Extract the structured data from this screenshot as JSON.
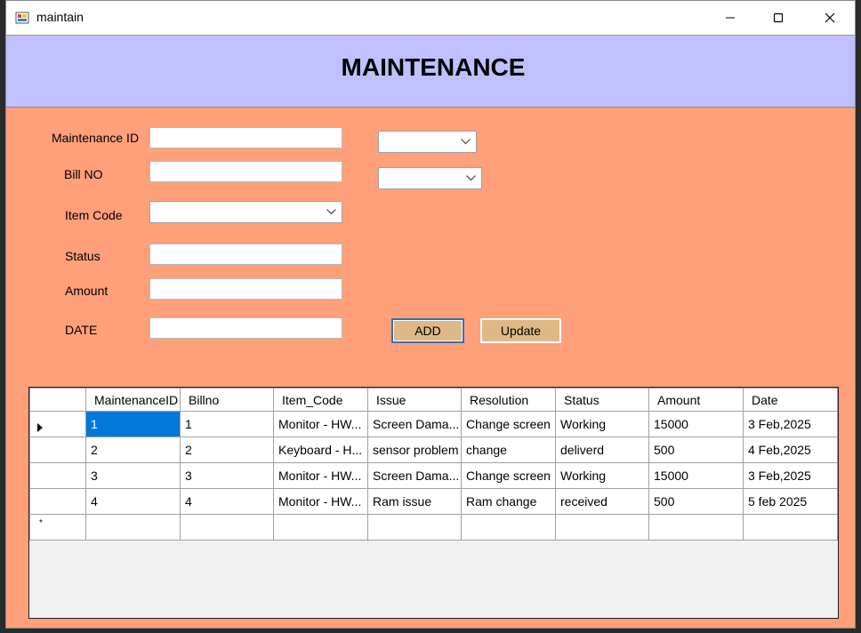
{
  "window": {
    "title": "maintain"
  },
  "header": {
    "title": "MAINTENANCE"
  },
  "form": {
    "maintenance_id_label": "Maintenance ID",
    "maintenance_id_value": "",
    "bill_no_label": "Bill NO",
    "bill_no_value": "",
    "item_code_label": "Item Code",
    "item_code_value": "",
    "status_label": "Status",
    "status_value": "",
    "amount_label": "Amount",
    "amount_value": "",
    "date_label": "DATE",
    "date_value": "",
    "combo1_value": "",
    "combo2_value": "",
    "add_label": "ADD",
    "update_label": "Update"
  },
  "grid": {
    "columns": [
      "MaintenanceID",
      "Billno",
      "Item_Code",
      "Issue",
      "Resolution",
      "Status",
      "Amount",
      "Date"
    ],
    "rows": [
      [
        "1",
        "1",
        "Monitor - HW...",
        "Screen Dama...",
        "Change screen",
        "Working",
        "15000",
        "3 Feb,2025"
      ],
      [
        "2",
        "2",
        "Keyboard - H...",
        "sensor problem",
        "change",
        "deliverd",
        "500",
        "4 Feb,2025"
      ],
      [
        "3",
        "3",
        "Monitor - HW...",
        "Screen Dama...",
        "Change screen",
        "Working",
        "15000",
        "3 Feb,2025"
      ],
      [
        "4",
        "4",
        "Monitor - HW...",
        "Ram issue",
        "Ram change",
        "received",
        "500",
        "5 feb 2025"
      ]
    ],
    "current_row_marker": "▶",
    "new_row_marker": "*"
  },
  "colors": {
    "header_bg": "#c0c0ff",
    "form_bg": "#ffa07a",
    "button_bg": "#deb887",
    "selection": "#0078d7"
  }
}
